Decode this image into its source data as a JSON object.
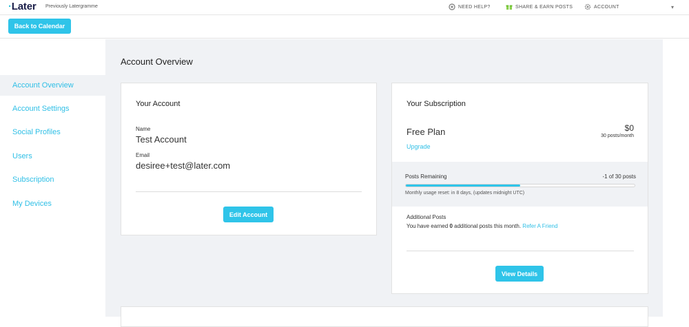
{
  "topbar": {
    "logo_text": "Later",
    "logo_sub": "Previously Latergramme",
    "nav": [
      {
        "label": "NEED HELP?",
        "icon": "help-icon"
      },
      {
        "label": "SHARE & EARN POSTS",
        "icon": "gift-icon"
      },
      {
        "label": "ACCOUNT",
        "icon": "gear-icon"
      }
    ],
    "caret_glyph": "▾"
  },
  "subbar": {
    "back_label": "Back to Calendar"
  },
  "sidebar": {
    "items": [
      {
        "label": "Account Overview",
        "active": true
      },
      {
        "label": "Account Settings"
      },
      {
        "label": "Social Profiles"
      },
      {
        "label": "Users"
      },
      {
        "label": "Subscription"
      },
      {
        "label": "My Devices"
      }
    ]
  },
  "main": {
    "title": "Account Overview",
    "account_card": {
      "title": "Your Account",
      "name_label": "Name",
      "name_value": "Test Account",
      "email_label": "Email",
      "email_value": "desiree+test@later.com",
      "edit_label": "Edit Account"
    },
    "subscription_card": {
      "title": "Your Subscription",
      "plan_name": "Free Plan",
      "upgrade_label": "Upgrade",
      "price": "$0",
      "posts_per_month": "30 posts/month",
      "posts_remaining_label": "Posts Remaining",
      "posts_remaining_value": "-1 of 30 posts",
      "progress_percent": 50,
      "reset_note": "Monthly usage reset: in 8 days, (updates midnight UTC)",
      "additional_title": "Additional Posts",
      "additional_prefix": "You have earned ",
      "additional_count": "0",
      "additional_suffix": " additional posts this month.",
      "refer_label": "Refer A Friend",
      "view_details_label": "View Details"
    }
  },
  "colors": {
    "accent": "#2fc4e9",
    "link": "#2fbfe6",
    "background": "#f0f2f5",
    "logo": "#1c1f4a"
  }
}
